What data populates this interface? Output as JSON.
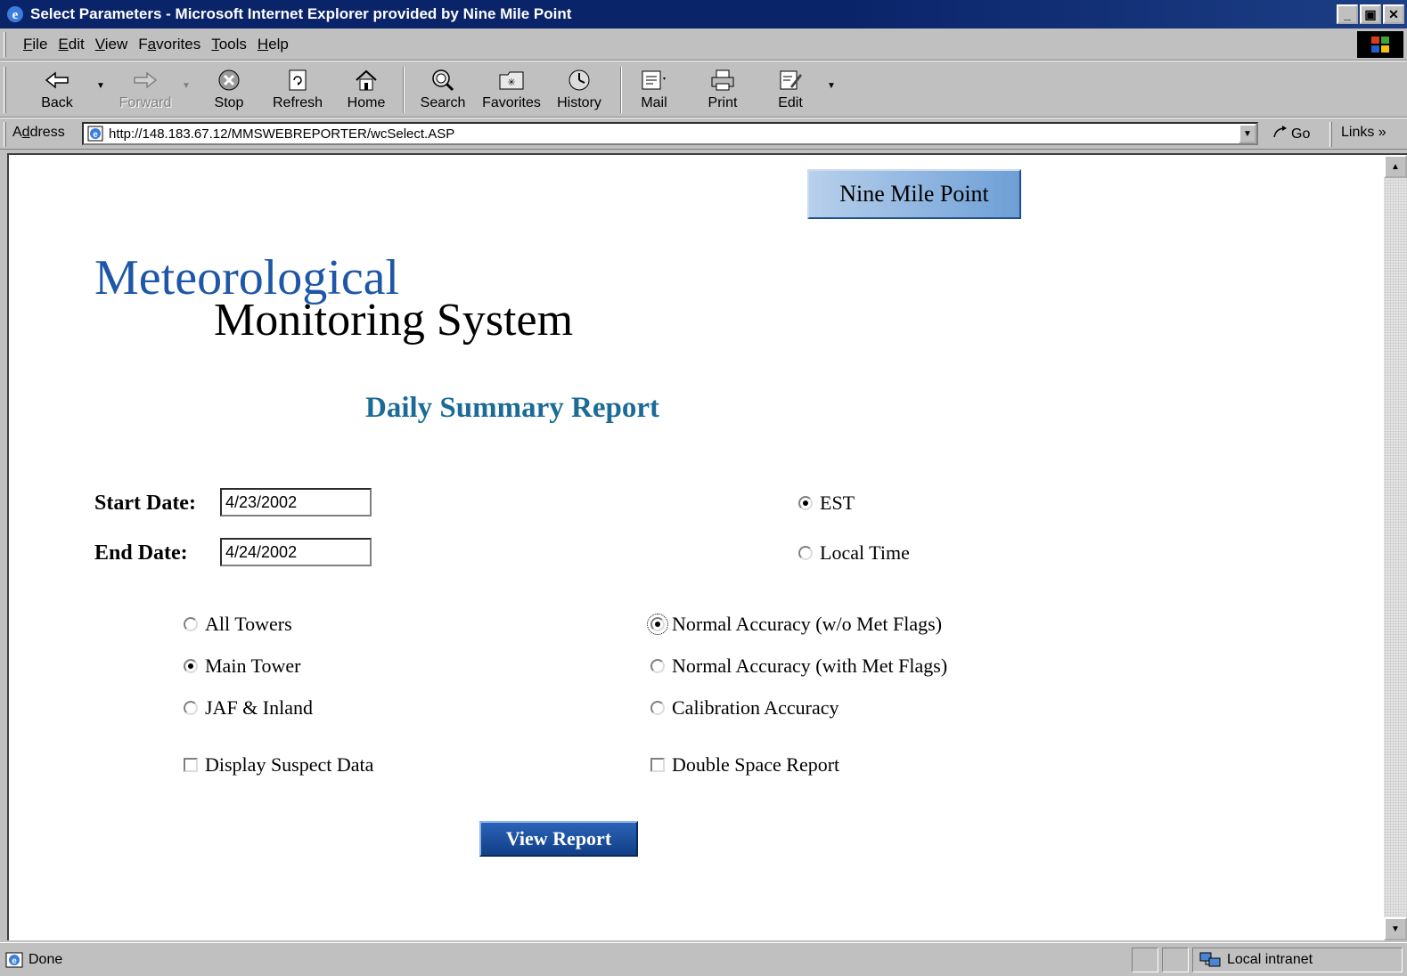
{
  "window": {
    "title": "Select Parameters - Microsoft Internet Explorer provided by Nine Mile Point",
    "buttons": {
      "minimize": "_",
      "maximize": "▣",
      "close": "✕"
    }
  },
  "menu": {
    "items": [
      {
        "ul": "F",
        "rest": "ile"
      },
      {
        "ul": "E",
        "rest": "dit"
      },
      {
        "ul": "V",
        "rest": "iew"
      },
      {
        "pre": "F",
        "ul": "a",
        "rest": "vorites"
      },
      {
        "ul": "T",
        "rest": "ools"
      },
      {
        "ul": "H",
        "rest": "elp"
      }
    ]
  },
  "toolbar": {
    "back": "Back",
    "forward": "Forward",
    "stop": "Stop",
    "refresh": "Refresh",
    "home": "Home",
    "search": "Search",
    "favorites": "Favorites",
    "history": "History",
    "mail": "Mail",
    "print": "Print",
    "edit": "Edit"
  },
  "address": {
    "label_ul": "d",
    "label_pre": "A",
    "label_rest": "dress",
    "url": "http://148.183.67.12/MMSWEBREPORTER/wcSelect.ASP",
    "go": "Go",
    "links": "Links »"
  },
  "page": {
    "site_button": "Nine Mile Point",
    "logo_line1": "Meteorological",
    "logo_line2": "Monitoring System",
    "report_title": "Daily Summary Report",
    "start_date_label": "Start Date:",
    "start_date_value": "4/23/2002",
    "end_date_label": "End Date:",
    "end_date_value": "4/24/2002",
    "time_options": {
      "est": "EST",
      "local": "Local Time",
      "selected": "EST"
    },
    "tower_options": {
      "all": "All Towers",
      "main": "Main Tower",
      "jaf": "JAF & Inland",
      "selected": "Main Tower"
    },
    "accuracy_options": {
      "normal_without": "Normal Accuracy (w/o Met Flags)",
      "normal_with": "Normal Accuracy (with Met Flags)",
      "calibration": "Calibration Accuracy",
      "selected": "Normal Accuracy (w/o Met Flags)"
    },
    "checkboxes": {
      "suspect": "Display Suspect Data",
      "double_space": "Double Space Report"
    },
    "view_button": "View Report"
  },
  "status": {
    "text": "Done",
    "zone": "Local intranet"
  },
  "colors": {
    "titlebar": "#0a246a",
    "logo_blue": "#1f57a8",
    "report_title": "#1b6b97",
    "button_blue": "#123f86"
  }
}
